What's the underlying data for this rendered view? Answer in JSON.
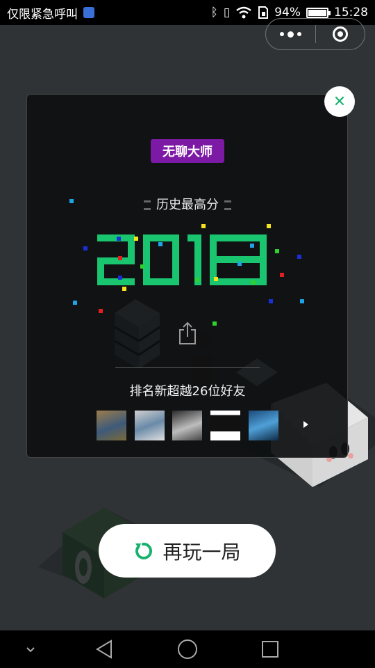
{
  "status_bar": {
    "carrier_text": "仅限紧急呼叫",
    "battery_text": "94%",
    "battery_level": 0.94,
    "time": "15:28",
    "icons": [
      "app-notification-icon",
      "bluetooth-icon",
      "vibrate-icon",
      "wifi-icon",
      "sim-icon",
      "battery-icon"
    ]
  },
  "capsule": {
    "more_icon": "more-dots-icon",
    "close_icon": "target-close-icon"
  },
  "result_panel": {
    "badge": "无聊大师",
    "badge_color": "#7c1aa6",
    "history_label": "历史最高分",
    "score": "2018",
    "score_color": "#19c56f",
    "share_icon": "share-icon",
    "rank_text": "排名新超越26位好友",
    "friends_more_icon": "play-arrow-icon",
    "friend_avatars": [
      "friend-avatar-1",
      "friend-avatar-2",
      "friend-avatar-3",
      "friend-avatar-4",
      "friend-avatar-5"
    ]
  },
  "close_button_icon": "close-x-icon",
  "replay_button": {
    "label": "再玩一局",
    "icon": "replay-icon",
    "accent": "#18b26d"
  },
  "nav_bar": {
    "icons": [
      "collapse-icon",
      "back-icon",
      "home-icon",
      "recents-icon"
    ]
  }
}
